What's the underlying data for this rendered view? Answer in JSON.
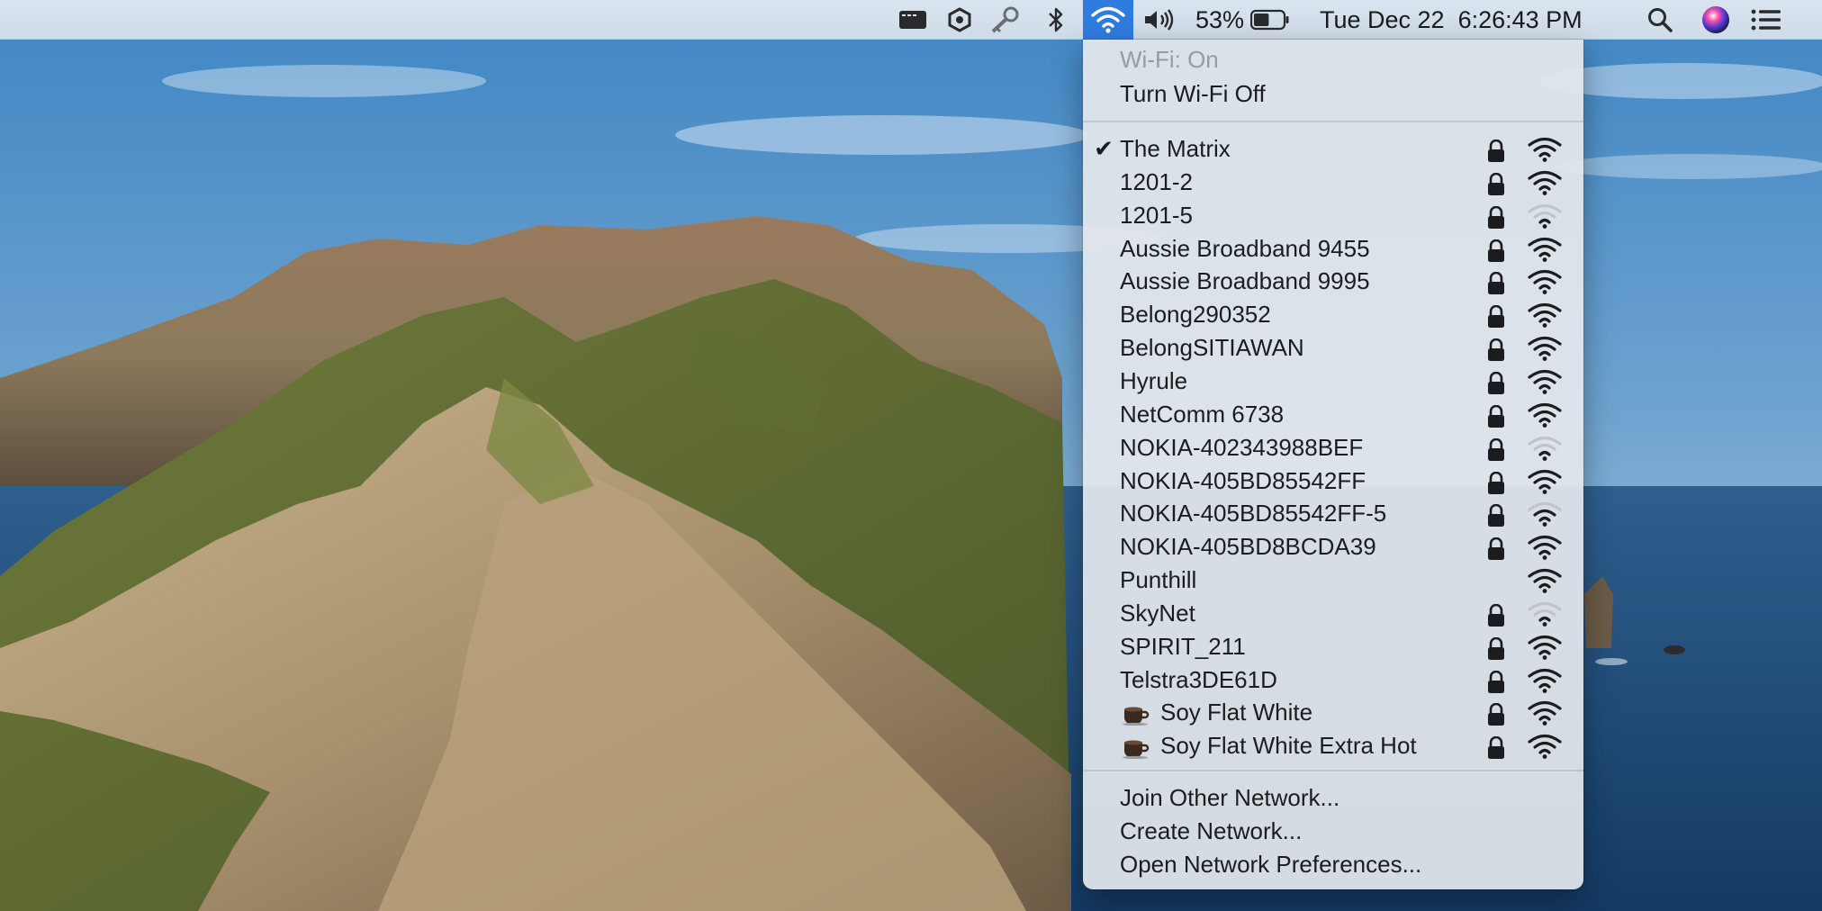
{
  "menubar": {
    "battery_percent": "53%",
    "battery_level": 0.53,
    "datetime": "Tue Dec 22  6:26:43 PM",
    "icons": [
      "window-icon",
      "app-status-icon",
      "key-icon",
      "bluetooth-icon",
      "wifi-icon",
      "volume-icon",
      "battery-icon",
      "spotlight-search-icon",
      "siri-icon",
      "notification-center-icon"
    ]
  },
  "wifi_menu": {
    "status": "Wi-Fi: On",
    "toggle": "Turn Wi-Fi Off",
    "networks": [
      {
        "name": "The Matrix",
        "connected": true,
        "locked": true,
        "strength": 3
      },
      {
        "name": "1201-2",
        "connected": false,
        "locked": true,
        "strength": 3
      },
      {
        "name": "1201-5",
        "connected": false,
        "locked": true,
        "strength": 1
      },
      {
        "name": "Aussie Broadband 9455",
        "connected": false,
        "locked": true,
        "strength": 3
      },
      {
        "name": "Aussie Broadband 9995",
        "connected": false,
        "locked": true,
        "strength": 3
      },
      {
        "name": "Belong290352",
        "connected": false,
        "locked": true,
        "strength": 3
      },
      {
        "name": "BelongSITIAWAN",
        "connected": false,
        "locked": true,
        "strength": 3
      },
      {
        "name": "Hyrule",
        "connected": false,
        "locked": true,
        "strength": 3
      },
      {
        "name": "NetComm 6738",
        "connected": false,
        "locked": true,
        "strength": 3
      },
      {
        "name": "NOKIA-402343988BEF",
        "connected": false,
        "locked": true,
        "strength": 1
      },
      {
        "name": "NOKIA-405BD85542FF",
        "connected": false,
        "locked": true,
        "strength": 3
      },
      {
        "name": "NOKIA-405BD85542FF-5",
        "connected": false,
        "locked": true,
        "strength": 2
      },
      {
        "name": "NOKIA-405BD8BCDA39",
        "connected": false,
        "locked": true,
        "strength": 3
      },
      {
        "name": "Punthill",
        "connected": false,
        "locked": false,
        "strength": 3
      },
      {
        "name": "SkyNet",
        "connected": false,
        "locked": true,
        "strength": 1
      },
      {
        "name": "SPIRIT_211",
        "connected": false,
        "locked": true,
        "strength": 3
      },
      {
        "name": "Telstra3DE61D",
        "connected": false,
        "locked": true,
        "strength": 3
      },
      {
        "name": "Soy Flat White",
        "connected": false,
        "locked": true,
        "strength": 3,
        "icon": "coffee-cup-icon"
      },
      {
        "name": "Soy Flat White Extra Hot",
        "connected": false,
        "locked": true,
        "strength": 3,
        "icon": "coffee-cup-icon"
      }
    ],
    "actions": [
      "Join Other Network...",
      "Create Network...",
      "Open Network Preferences..."
    ]
  },
  "colors": {
    "menubar_highlight": "#2f7ce0",
    "menu_background": "#e4e7ec",
    "text": "#1c1c1e",
    "disabled_text": "#9a9b9e"
  }
}
